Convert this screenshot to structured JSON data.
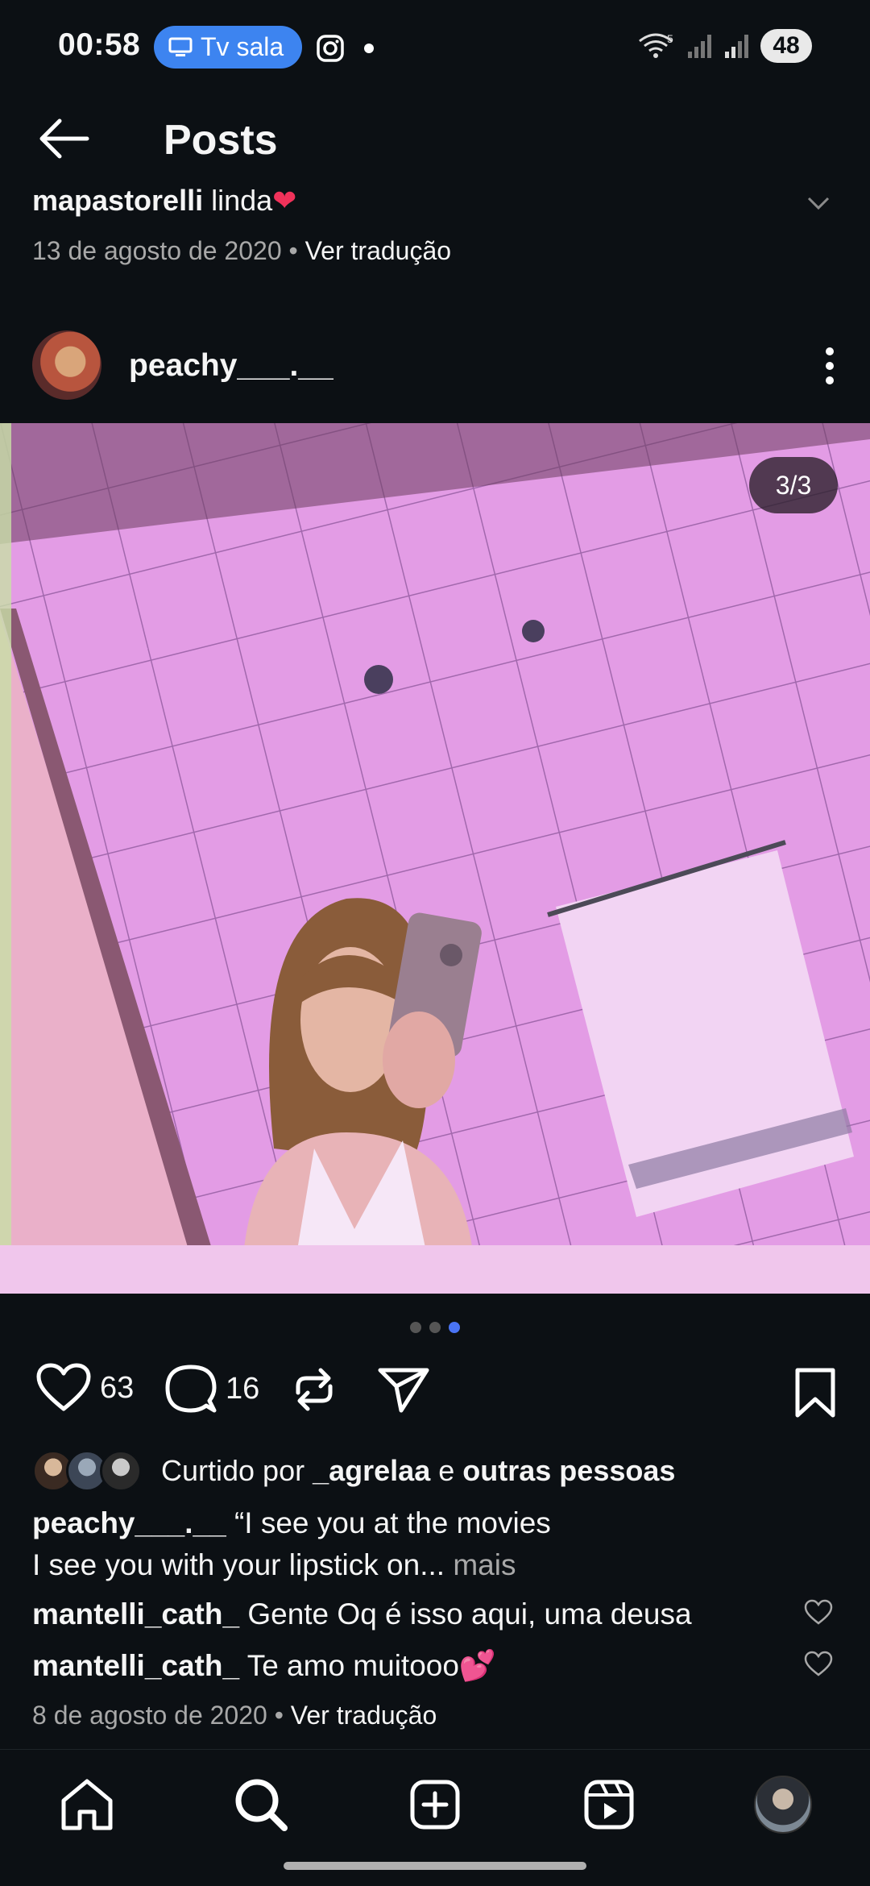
{
  "status_bar": {
    "time": "00:58",
    "cast_label": "Tv sala",
    "battery": "48",
    "wifi_sub": "5"
  },
  "header": {
    "title": "Posts"
  },
  "previous_post": {
    "username": "mapastorelli",
    "comment": "linda",
    "date": "13 de agosto de 2020",
    "translate": "Ver tradução"
  },
  "post": {
    "username": "peachy___.__",
    "counter": "3/3",
    "likes": "63",
    "comments": "16",
    "liked_by_prefix": "Curtido por",
    "liked_by_user": "_agrelaa",
    "liked_by_conj": "e",
    "liked_by_rest": "outras pessoas",
    "caption_user": "peachy___.__",
    "caption_line1": "“I see you at the movies",
    "caption_line2": "I see you with your lipstick on...",
    "more": "mais",
    "comments_list": [
      {
        "user": "mantelli_cath_",
        "text": "Gente Oq é isso aqui, uma deusa"
      },
      {
        "user": "mantelli_cath_",
        "text": "Te amo muitooo💕"
      }
    ],
    "date": "8 de agosto de 2020",
    "translate": "Ver tradução"
  },
  "colors": {
    "background": "#0c1014",
    "accent_blue": "#3d84f0",
    "pager_active": "#4a74f5",
    "muted_text": "#a8a8a8"
  },
  "nav": {
    "items": [
      "home-icon",
      "search-icon",
      "create-icon",
      "reels-icon",
      "profile-avatar"
    ]
  }
}
